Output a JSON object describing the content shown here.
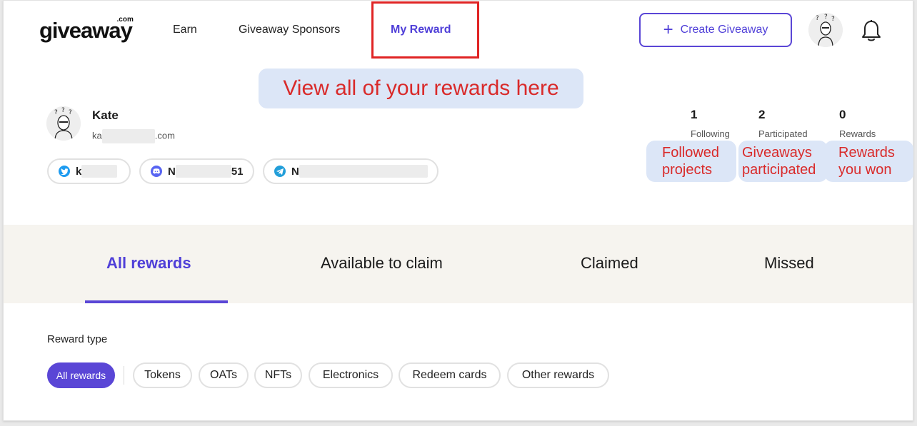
{
  "header": {
    "logo_text": "giveaway",
    "logo_suffix": ".com",
    "nav": [
      "Earn",
      "Giveaway Sponsors",
      "My Reward"
    ],
    "active_nav": "My Reward",
    "create_button_label": "Create Giveaway",
    "create_button_icon": "plus-icon",
    "notification_icon": "bell-icon"
  },
  "callouts": {
    "main": "View all of your rewards here",
    "following_hint": [
      "Followed",
      "projects"
    ],
    "participated_hint": [
      "Giveaways",
      "participated"
    ],
    "rewards_hint": [
      "Rewards",
      "you won"
    ]
  },
  "profile": {
    "name": "Kate",
    "email_visible_start": "ka",
    "email_visible_end": ".com",
    "socials": [
      {
        "icon": "twitter-icon",
        "visible_prefix": "k",
        "visible_suffix": ""
      },
      {
        "icon": "discord-icon",
        "visible_prefix": "N",
        "visible_suffix": "51"
      },
      {
        "icon": "telegram-icon",
        "visible_prefix": "N",
        "visible_suffix": ""
      }
    ]
  },
  "stats": [
    {
      "value": "1",
      "label": "Following"
    },
    {
      "value": "2",
      "label": "Participated"
    },
    {
      "value": "0",
      "label": "Rewards"
    }
  ],
  "tabs": {
    "items": [
      "All rewards",
      "Available to claim",
      "Claimed",
      "Missed"
    ],
    "active": "All rewards"
  },
  "filters": {
    "label": "Reward type",
    "chips": [
      "All rewards",
      "Tokens",
      "OATs",
      "NFTs",
      "Electronics",
      "Redeem cards",
      "Other rewards"
    ],
    "active": "All rewards"
  },
  "colors": {
    "accent": "#5a46d6",
    "annotation_red": "#d92a2a",
    "annotation_bg": "#dce6f7",
    "tabs_bg": "#f6f4ef"
  }
}
